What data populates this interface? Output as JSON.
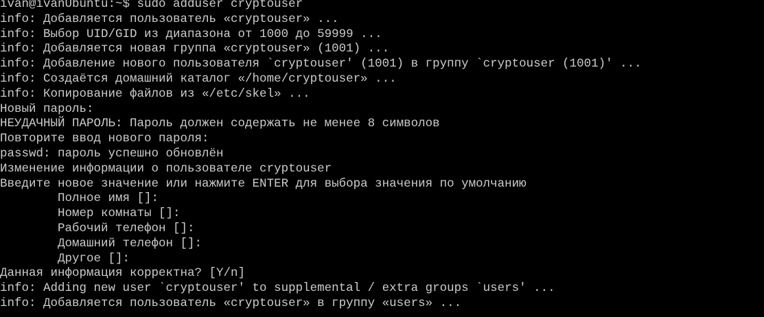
{
  "terminal": {
    "foreground": "#cccccc",
    "background": "#000000",
    "lines": [
      "ivan@ivanUbuntu:~$ sudo adduser cryptouser",
      "info: Добавляется пользователь «cryptouser» ...",
      "info: Выбор UID/GID из диапазона от 1000 до 59999 ...",
      "info: Добавляется новая группа «cryptouser» (1001) ...",
      "info: Добавление нового пользователя `cryptouser' (1001) в группу `cryptouser (1001)' ...",
      "info: Создаётся домашний каталог «/home/cryptouser» ...",
      "info: Копирование файлов из «/etc/skel» ...",
      "Новый пароль:",
      "НЕУДАЧНЫЙ ПАРОЛЬ: Пароль должен содержать не менее 8 символов",
      "Повторите ввод нового пароля:",
      "passwd: пароль успешно обновлён",
      "Изменение информации о пользователе cryptouser",
      "Введите новое значение или нажмите ENTER для выбора значения по умолчанию",
      "        Полное имя []:",
      "        Номер комнаты []:",
      "        Рабочий телефон []:",
      "        Домашний телефон []:",
      "        Другое []:",
      "Данная информация корректна? [Y/n]",
      "info: Adding new user `cryptouser' to supplemental / extra groups `users' ...",
      "info: Добавляется пользователь «cryptouser» в группу «users» ..."
    ]
  }
}
